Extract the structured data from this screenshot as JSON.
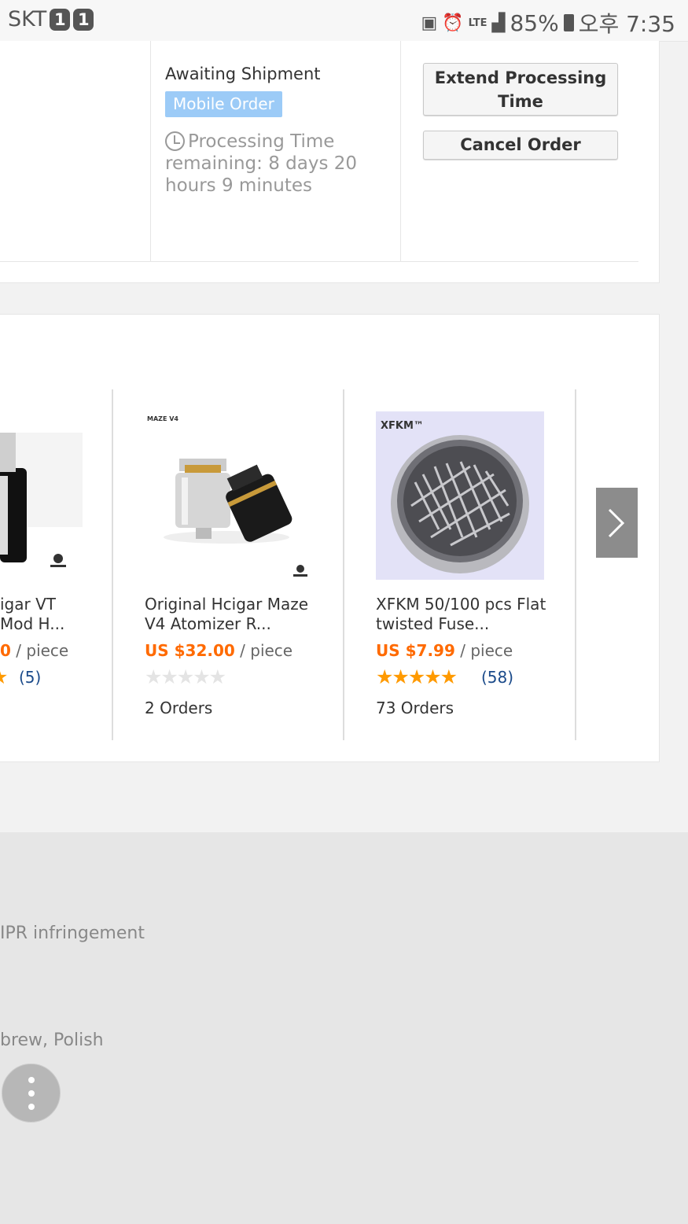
{
  "status_bar": {
    "carrier": "SKT",
    "sim1": "1",
    "sim2": "1",
    "network": "LTE",
    "battery": "85%",
    "time": "오후 7:35"
  },
  "order": {
    "status": "Awaiting Shipment",
    "badge": "Mobile Order",
    "processing_text": "Processing Time remaining: 8 days 20 hours 9 minutes",
    "extend_button": "Extend Processing Time",
    "cancel_button": "Cancel Order"
  },
  "recommendations": {
    "products": [
      {
        "title_line1": "igar VT",
        "title_line2": "Mod H...",
        "price_tail": "0",
        "unit": "/ piece",
        "rating_count": "(5)"
      },
      {
        "title": "Original Hcigar Maze V4 Atomizer R...",
        "price": "US $32.00",
        "unit": "/ piece",
        "rating": 0,
        "orders": "2 Orders",
        "image_brand": "MAZE V4"
      },
      {
        "title": "XFKM 50/100 pcs Flat twisted Fuse...",
        "price": "US $7.99",
        "unit": "/ piece",
        "rating": 5,
        "rating_count": "(58)",
        "orders": "73 Orders",
        "image_brand": "XFKM™"
      }
    ],
    "next_icon": "chevron-right-icon"
  },
  "footer": {
    "ipr_text": "IPR infringement",
    "languages_text": "brew, Polish",
    "menu_icon": "more-vertical-icon"
  },
  "colors": {
    "price": "#ff6a00",
    "star": "#ff9a00",
    "badge": "#9ccbf7",
    "link": "#1a4a8a"
  }
}
